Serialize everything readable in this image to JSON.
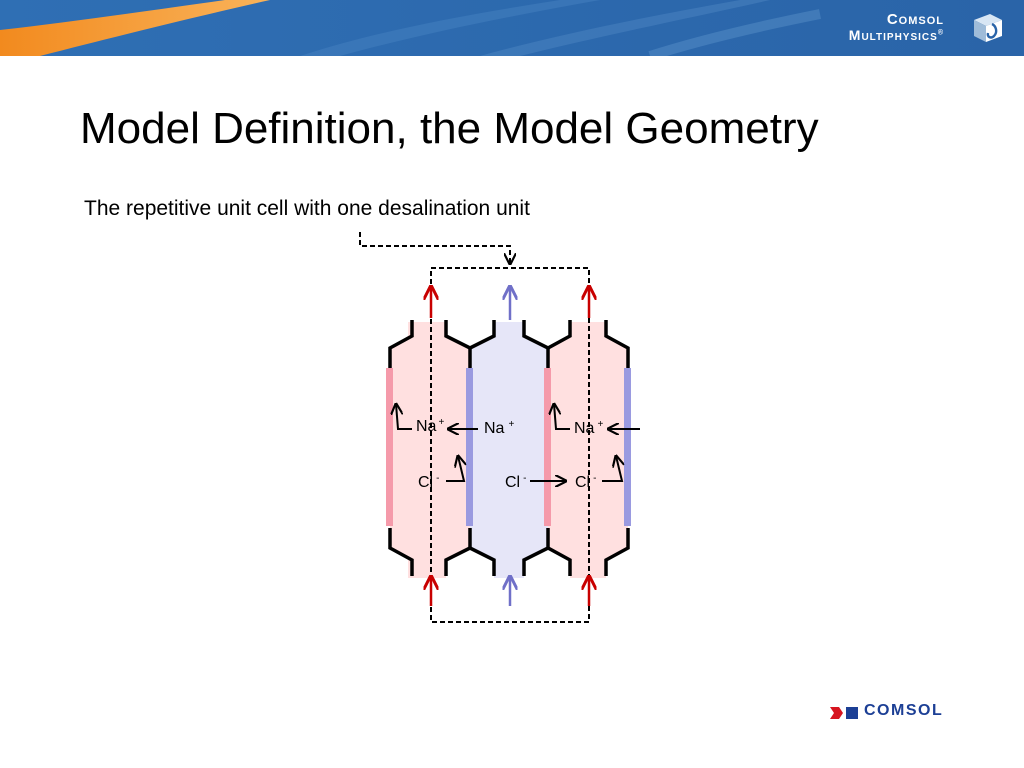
{
  "header": {
    "logo_line1": "Comsol",
    "logo_line2": "Multiphysics",
    "logo_registered": "®"
  },
  "slide": {
    "title": "Model Definition, the Model Geometry",
    "caption": "The repetitive unit cell with one desalination unit"
  },
  "diagram": {
    "labels": {
      "na_1": "Na",
      "na_2": "Na",
      "na_3": "Na",
      "cl_1": "Cl",
      "cl_2": "Cl",
      "cl_3": "Cl",
      "plus": "+",
      "minus": "-"
    },
    "colors": {
      "concentrate_channel": "#ffe0e0",
      "dilute_channel": "#e6e6f8",
      "cation_membrane": "#f59aaa",
      "anion_membrane": "#9a9ae0",
      "red_arrow": "#c80000",
      "blue_arrow": "#7070c8",
      "wall": "#000000",
      "unit_cell_border": "#000000"
    }
  },
  "footer": {
    "logo_text": "COMSOL",
    "logo_color": "#1c3f95",
    "logo_accent": "#d7141f"
  }
}
